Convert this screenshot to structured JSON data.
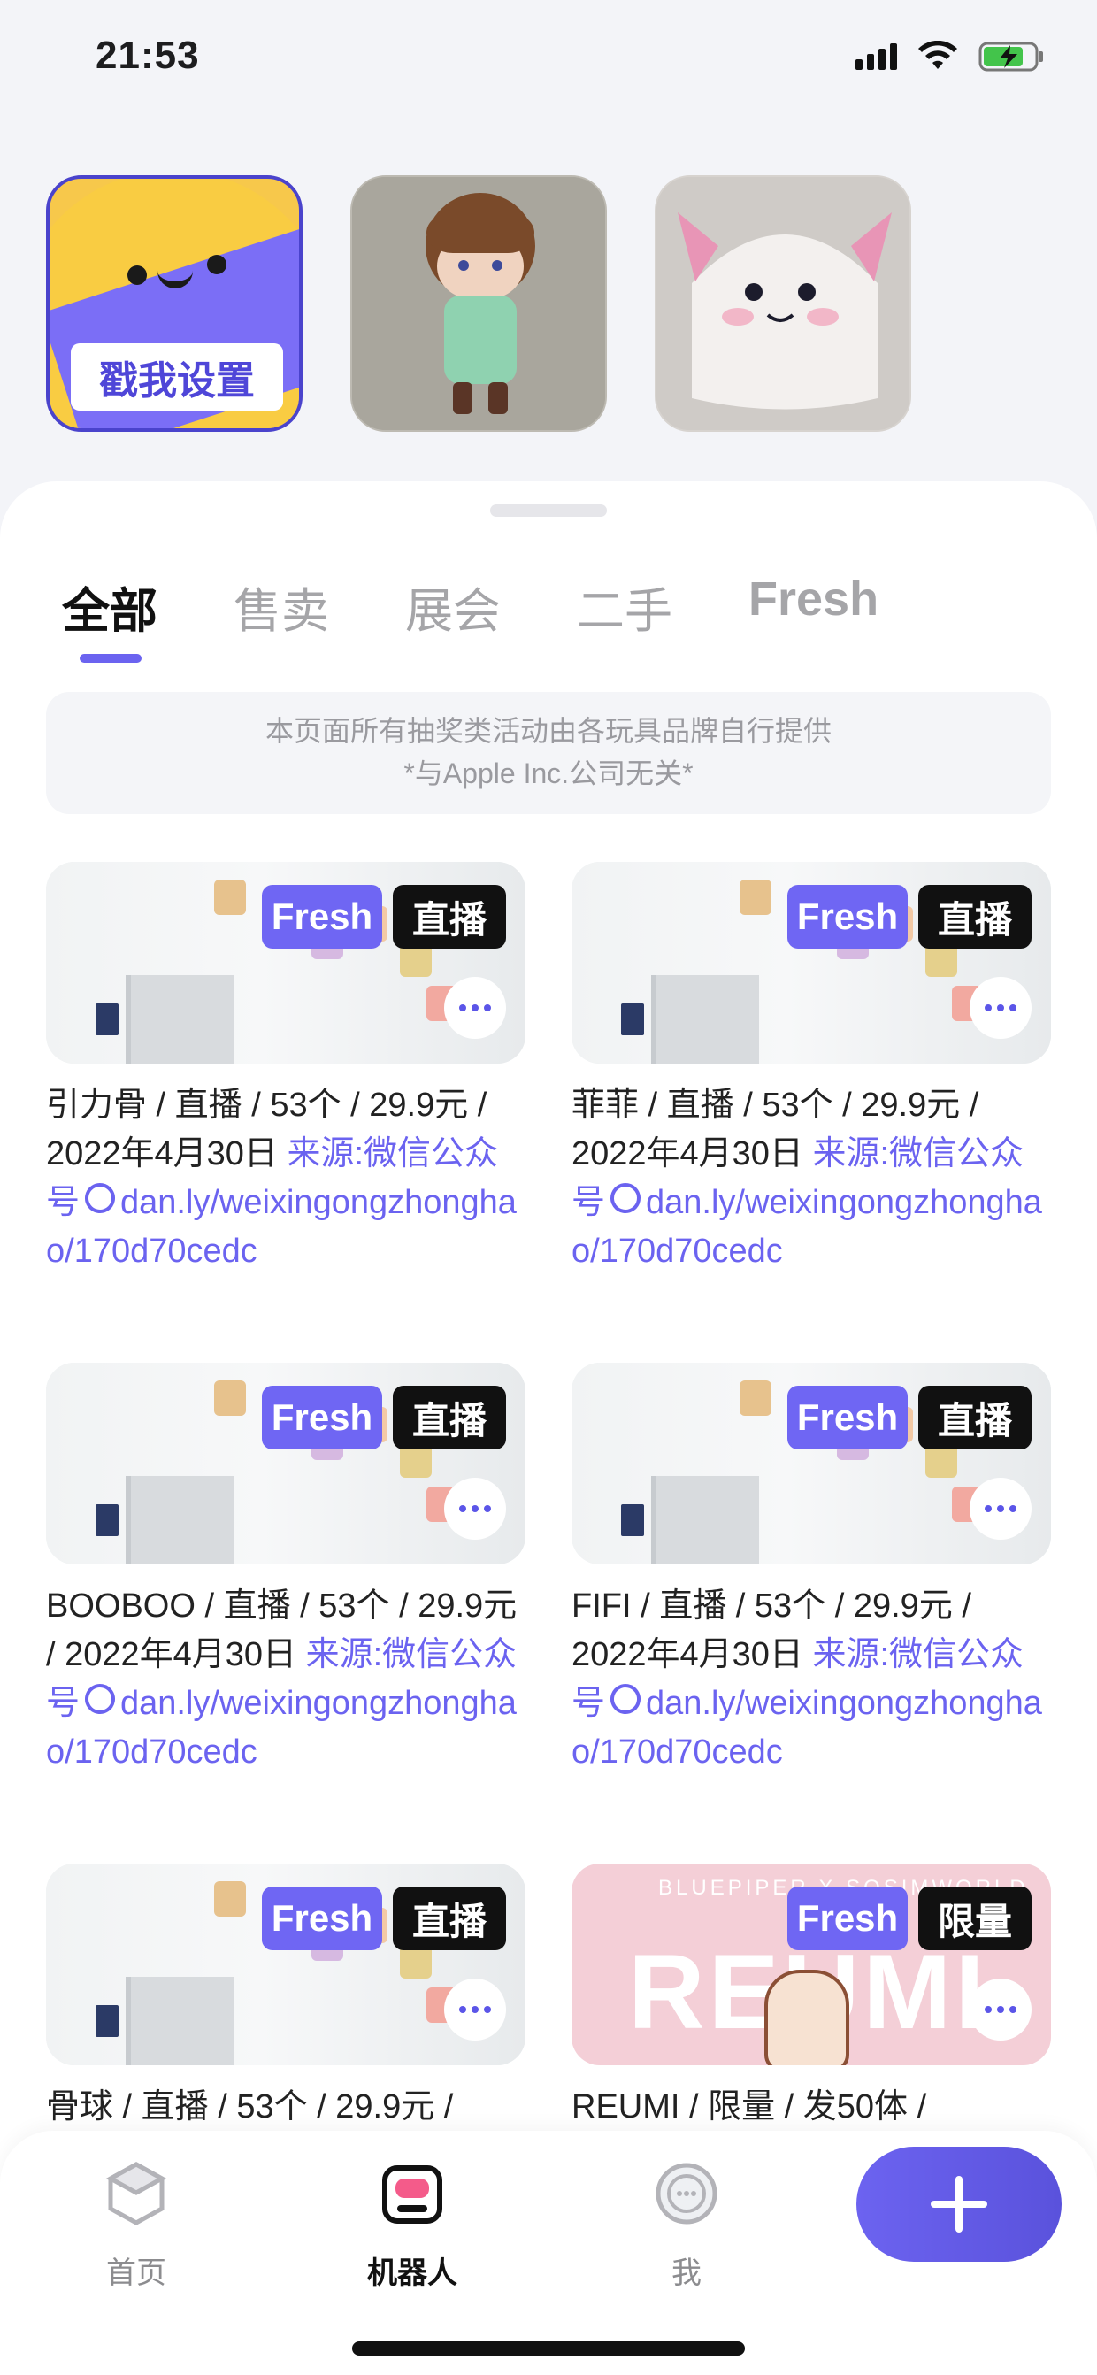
{
  "status_bar": {
    "time": "21:53"
  },
  "avatars": [
    {
      "label": "戳我设置"
    }
  ],
  "tabs": [
    "全部",
    "售卖",
    "展会",
    "二手",
    "Fresh"
  ],
  "notice": {
    "line1": "本页面所有抽奖类活动由各玩具品牌自行提供",
    "line2": "*与Apple Inc.公司无关*"
  },
  "cards": [
    {
      "fresh_badge": "Fresh",
      "type_badge": "直播",
      "prefix": "引力骨 / 直播 / 53个 / 29.9元 / 2022年4月30日 ",
      "source": "来源:微信公众号",
      "link": "dan.ly/weixingongzhonghao/170d70cedc"
    },
    {
      "fresh_badge": "Fresh",
      "type_badge": "直播",
      "prefix": "菲菲 / 直播 / 53个 / 29.9元 / 2022年4月30日 ",
      "source": "来源:微信公众号",
      "link": "dan.ly/weixingongzhonghao/170d70cedc"
    },
    {
      "fresh_badge": "Fresh",
      "type_badge": "直播",
      "prefix": "BOOBOO / 直播 / 53个 / 29.9元 / 2022年4月30日 ",
      "source": "来源:微信公众号",
      "link": "dan.ly/weixingongzhonghao/170d70cedc"
    },
    {
      "fresh_badge": "Fresh",
      "type_badge": "直播",
      "prefix": "FIFI / 直播 / 53个 / 29.9元 / 2022年4月30日 ",
      "source": "来源:微信公众号",
      "link": "dan.ly/weixingongzhonghao/170d70cedc"
    },
    {
      "fresh_badge": "Fresh",
      "type_badge": "直播",
      "prefix": "骨球 / 直播 / 53个 / 29.9元 /",
      "source": "",
      "link": ""
    },
    {
      "fresh_badge": "Fresh",
      "type_badge": "限量",
      "prefix": "REUMI / 限量 / 发50体 /",
      "source": "",
      "link": "",
      "poster_title": "REUMI",
      "poster_sub": "BLUEPIPER X SOSIMWORLD"
    }
  ],
  "bottom_nav": [
    {
      "label": "首页",
      "icon": "cube-icon"
    },
    {
      "label": "机器人",
      "icon": "robot-icon"
    },
    {
      "label": "我",
      "icon": "profile-icon"
    }
  ],
  "fab": {
    "icon": "plus-icon"
  },
  "colors": {
    "accent": "#6b63f0",
    "fresh_badge": "#6f66f3",
    "type_badge": "#111111"
  }
}
